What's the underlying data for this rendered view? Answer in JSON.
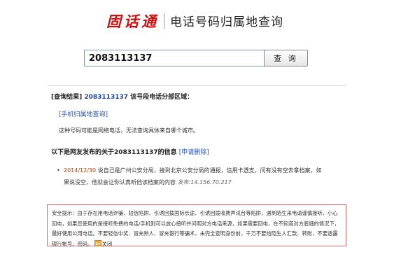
{
  "header": {
    "logo_text": "固话通",
    "title": "电话号码归属地查询"
  },
  "search": {
    "value": "2083113137",
    "button_label": "查 询"
  },
  "result": {
    "prefix": "[查询结果]",
    "number": "2083113137",
    "text": "该号段电话分部区域："
  },
  "mobile_link": {
    "open": "[",
    "label": "手机归属地查询",
    "close": "]"
  },
  "network_note": "这种号码可能是网络电话，无法查询具体来自哪个城市。",
  "netizen": {
    "heading": "以下是网友发布的关于2083113137的信息",
    "apply_label": "[申请删除]"
  },
  "reports": [
    {
      "bullet": "•",
      "date": "2014/12/30",
      "text": "说自己是广州公安分局，接到北京公安分局的通报，信用卡透支，问有没有空去拿档案，如果说没空，他就会让你认真听他读档案的内容",
      "meta": "发布:14.156.70.217"
    }
  ],
  "notice": {
    "text": "安全提示：由于存在用电话诈骗、短信陷阱、引诱回拨国际长途、引诱回拨收费声讯台等陷阱，遇到陌生来电请谨慎接听、小心回电，如果您使用的是接听免费的电话/手机则可以放心接听并问明对方电话来源，如果需要回电，在不知道对方底细的情况下，最好使用公用电话。不要轻信中奖、冒充熟人、冒充银行等骗术，未完全查明身份前，千万不要给陌生人汇款、转账，不要透露银行帐号、密码。",
    "close_label": "关闭"
  },
  "colors": {
    "logo": "#cc1111",
    "link": "#2255cc",
    "number": "#1a44a3",
    "date": "#c23b00",
    "notice_border": "#d66a6a"
  }
}
